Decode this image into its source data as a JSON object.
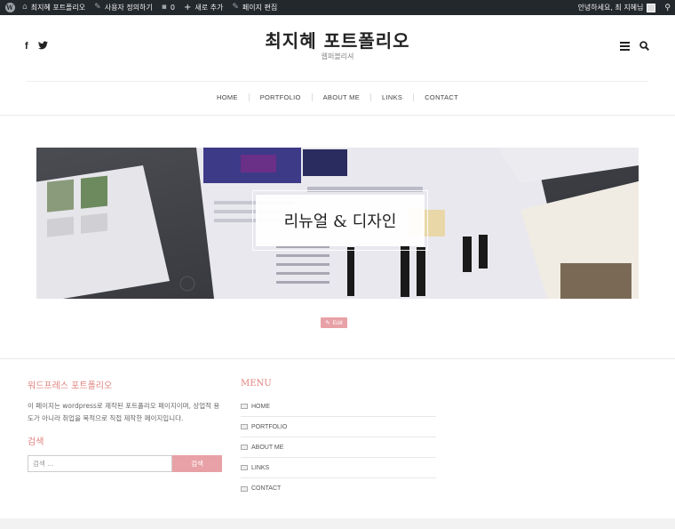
{
  "adminbar": {
    "site_name": "최지혜 포트폴리오",
    "customize": "사용자 정의하기",
    "comments_count": "0",
    "new_item": "새로 추가",
    "edit_page": "페이지 편집",
    "greeting": "안녕하세요, 최 지혜님"
  },
  "header": {
    "site_title": "최지혜 포트폴리오",
    "site_description": "웹퍼블리셔",
    "social_icons": [
      "facebook-icon",
      "twitter-icon"
    ],
    "tool_icons": [
      "menu-icon",
      "search-icon"
    ]
  },
  "nav": {
    "items": [
      "HOME",
      "PORTFOLIO",
      "ABOUT ME",
      "LINKS",
      "CONTACT"
    ]
  },
  "banner": {
    "caption": "리뉴얼 & 디자인"
  },
  "edit": {
    "label": "Edit"
  },
  "footer": {
    "widget1_title": "워드프레스 포트폴리오",
    "widget1_text": "이 페이지는 wordpress로 제작된 포트폴리오 페이지이며, 상업적 용도가 아니라 취업을 목적으로 직접 제작한 페이지입니다.",
    "search_title": "검색",
    "search_placeholder": "검색 ...",
    "search_button": "검색",
    "menu_title": "MENU",
    "menu_items": [
      "HOME",
      "PORTFOLIO",
      "ABOUT ME",
      "LINKS",
      "CONTACT"
    ]
  },
  "colors": {
    "accent": "#e8a1a6",
    "widget_title": "#e0827f",
    "adminbar_bg": "#23282d"
  }
}
